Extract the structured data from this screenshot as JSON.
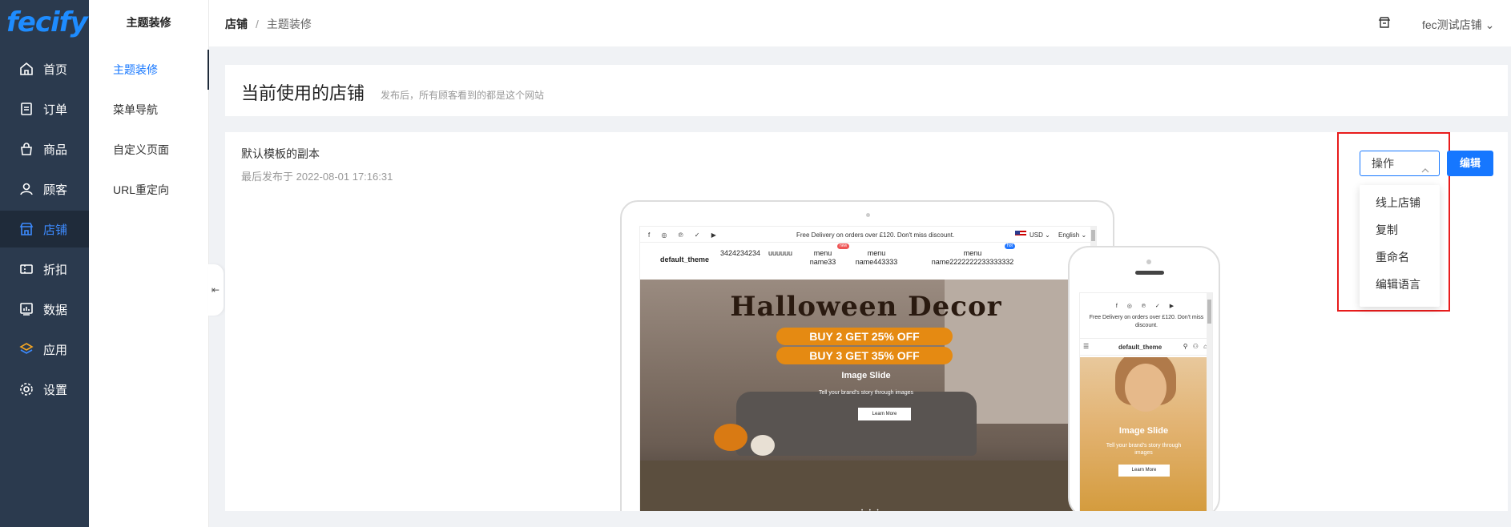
{
  "app": {
    "logo": "fecify"
  },
  "sidebar": {
    "items": [
      {
        "label": "首页",
        "icon": "home-icon"
      },
      {
        "label": "订单",
        "icon": "order-icon"
      },
      {
        "label": "商品",
        "icon": "bag-icon"
      },
      {
        "label": "顾客",
        "icon": "user-icon"
      },
      {
        "label": "店铺",
        "icon": "store-icon"
      },
      {
        "label": "折扣",
        "icon": "coupon-icon"
      },
      {
        "label": "数据",
        "icon": "chart-icon"
      },
      {
        "label": "应用",
        "icon": "apps-icon"
      },
      {
        "label": "设置",
        "icon": "gear-icon"
      }
    ],
    "active_index": 4,
    "active_color": "#3d8bff"
  },
  "submenu": {
    "title": "主题装修",
    "items": [
      {
        "label": "主题装修"
      },
      {
        "label": "菜单导航"
      },
      {
        "label": "自定义页面"
      },
      {
        "label": "URL重定向"
      }
    ]
  },
  "header": {
    "breadcrumb": [
      "店铺",
      "主题装修"
    ],
    "store_name": "fec测试店铺"
  },
  "current_store": {
    "title": "当前使用的店铺",
    "subtitle": "发布后，所有顾客看到的都是这个网站"
  },
  "theme": {
    "name": "默认模板的副本",
    "published": "最后发布于 2022-08-01 17:16:31",
    "action_select": "操作",
    "edit_button": "编辑",
    "actions": [
      "线上店铺",
      "复制",
      "重命名",
      "编辑语言"
    ],
    "accent": "#1677ff",
    "highlight_color": "#e81c1c"
  },
  "preview": {
    "social": "f ◎ ℗ ✓ ▶",
    "promo": "Free Delivery on orders over £120. Don't miss discount.",
    "currency": "USD ⌄",
    "language": "English ⌄",
    "store_name": "default_theme",
    "nav": [
      "3424234234",
      "uuuuuu",
      "menu name33",
      "menu name443333",
      "menu name2222222233333332"
    ],
    "badge_new": "new",
    "badge_hot": "hot",
    "hero_title": "Halloween Decor",
    "offer1": "BUY 2 GET 25% OFF",
    "offer2": "BUY 3 GET 35% OFF",
    "slide_title": "Image Slide",
    "slide_sub": "Tell your brand's story through images",
    "learn_more": "Learn More",
    "dots": "• • •"
  },
  "mobile": {
    "promo": "Free Delivery on orders over £120. Don't miss discount.",
    "store_name": "default_theme",
    "slide_title": "Image Slide",
    "slide_sub": "Tell your brand's story through images",
    "learn_more": "Learn More"
  }
}
